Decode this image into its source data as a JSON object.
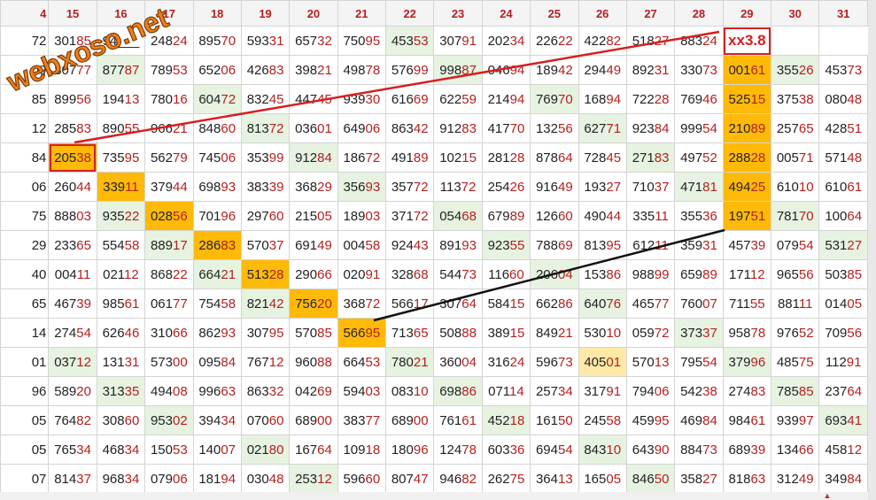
{
  "watermark": "webxoso.net",
  "grid": {
    "headers": [
      "4",
      "15",
      "16",
      "17",
      "18",
      "19",
      "20",
      "21",
      "22",
      "23",
      "24",
      "25",
      "26",
      "27",
      "28",
      "29",
      "30",
      "31"
    ],
    "rows": [
      [
        "72",
        "30185",
        "94___",
        "24824",
        "89570",
        "59331",
        "65732",
        "75095",
        "45353",
        "30791",
        "20234",
        "22622",
        "42282",
        "51827",
        "88324",
        "xx3.8",
        ""
      ],
      [
        "09",
        "80777",
        "87787",
        "78953",
        "65206",
        "42683",
        "39821",
        "49878",
        "57699",
        "99887",
        "04694",
        "18942",
        "29449",
        "89231",
        "33073",
        "00161",
        "35526",
        "45373"
      ],
      [
        "85",
        "89956",
        "19413",
        "78016",
        "60472",
        "83245",
        "44745",
        "93930",
        "61669",
        "62259",
        "21494",
        "76970",
        "16894",
        "72228",
        "76946",
        "52515",
        "37538",
        "08048"
      ],
      [
        "12",
        "28583",
        "89055",
        "96621",
        "84860",
        "81372",
        "03601",
        "64906",
        "86342",
        "91283",
        "41770",
        "13256",
        "62771",
        "92384",
        "99954",
        "21089",
        "25765",
        "42851"
      ],
      [
        "84",
        "20538",
        "73595",
        "56279",
        "74506",
        "35399",
        "91284",
        "18672",
        "49189",
        "10215",
        "28128",
        "87864",
        "72845",
        "27183",
        "49752",
        "28828",
        "00571",
        "57148"
      ],
      [
        "06",
        "26044",
        "33911",
        "37944",
        "69893",
        "38339",
        "36829",
        "35693",
        "35772",
        "11372",
        "25426",
        "91649",
        "19327",
        "71037",
        "47181",
        "49425",
        "61010",
        "61061"
      ],
      [
        "75",
        "88803",
        "93522",
        "02856",
        "70196",
        "29760",
        "21505",
        "18903",
        "37172",
        "05468",
        "67989",
        "12660",
        "49044",
        "33511",
        "35536",
        "19751",
        "78170",
        "10064"
      ],
      [
        "29",
        "23365",
        "55458",
        "88917",
        "28683",
        "57037",
        "69149",
        "00458",
        "92443",
        "89193",
        "92355",
        "78869",
        "81395",
        "61211",
        "35931",
        "45739",
        "07954",
        "53127"
      ],
      [
        "40",
        "00411",
        "02112",
        "86822",
        "66421",
        "51328",
        "29066",
        "02091",
        "32868",
        "54473",
        "11660",
        "20604",
        "15386",
        "98899",
        "65989",
        "17112",
        "96556",
        "50385"
      ],
      [
        "65",
        "46739",
        "98561",
        "06177",
        "75458",
        "82142",
        "75620",
        "36872",
        "56617",
        "30764",
        "58415",
        "66286",
        "64076",
        "46577",
        "76007",
        "71155",
        "88111",
        "01405"
      ],
      [
        "14",
        "27454",
        "62646",
        "31066",
        "86293",
        "30795",
        "57085",
        "56695",
        "71365",
        "50888",
        "38915",
        "84921",
        "53010",
        "05972",
        "37337",
        "95878",
        "97652",
        "70956"
      ],
      [
        "01",
        "03712",
        "13131",
        "57300",
        "09584",
        "76712",
        "96088",
        "66453",
        "78021",
        "36004",
        "31624",
        "59673",
        "40501",
        "57013",
        "79554",
        "37996",
        "48575",
        "11291"
      ],
      [
        "96",
        "58920",
        "31335",
        "49408",
        "99663",
        "86332",
        "04269",
        "59403",
        "08310",
        "69886",
        "07114",
        "25734",
        "31791",
        "79406",
        "54238",
        "27483",
        "78585",
        "23764"
      ],
      [
        "05",
        "76482",
        "30860",
        "95302",
        "39434",
        "07060",
        "68900",
        "38377",
        "68900",
        "76161",
        "45218",
        "16150",
        "24558",
        "45995",
        "46984",
        "98461",
        "93997",
        "69341"
      ],
      [
        "05",
        "76534",
        "46834",
        "15053",
        "14007",
        "02180",
        "16764",
        "10918",
        "18096",
        "12478",
        "60336",
        "69454",
        "84310",
        "64390",
        "88473",
        "68939",
        "13466",
        "45812"
      ],
      [
        "07",
        "81437",
        "96834",
        "07906",
        "18194",
        "03048",
        "25312",
        "59660",
        "80747",
        "94682",
        "26275",
        "36413",
        "16505",
        "84650",
        "35827",
        "81863",
        "31249",
        "34984"
      ]
    ]
  }
}
